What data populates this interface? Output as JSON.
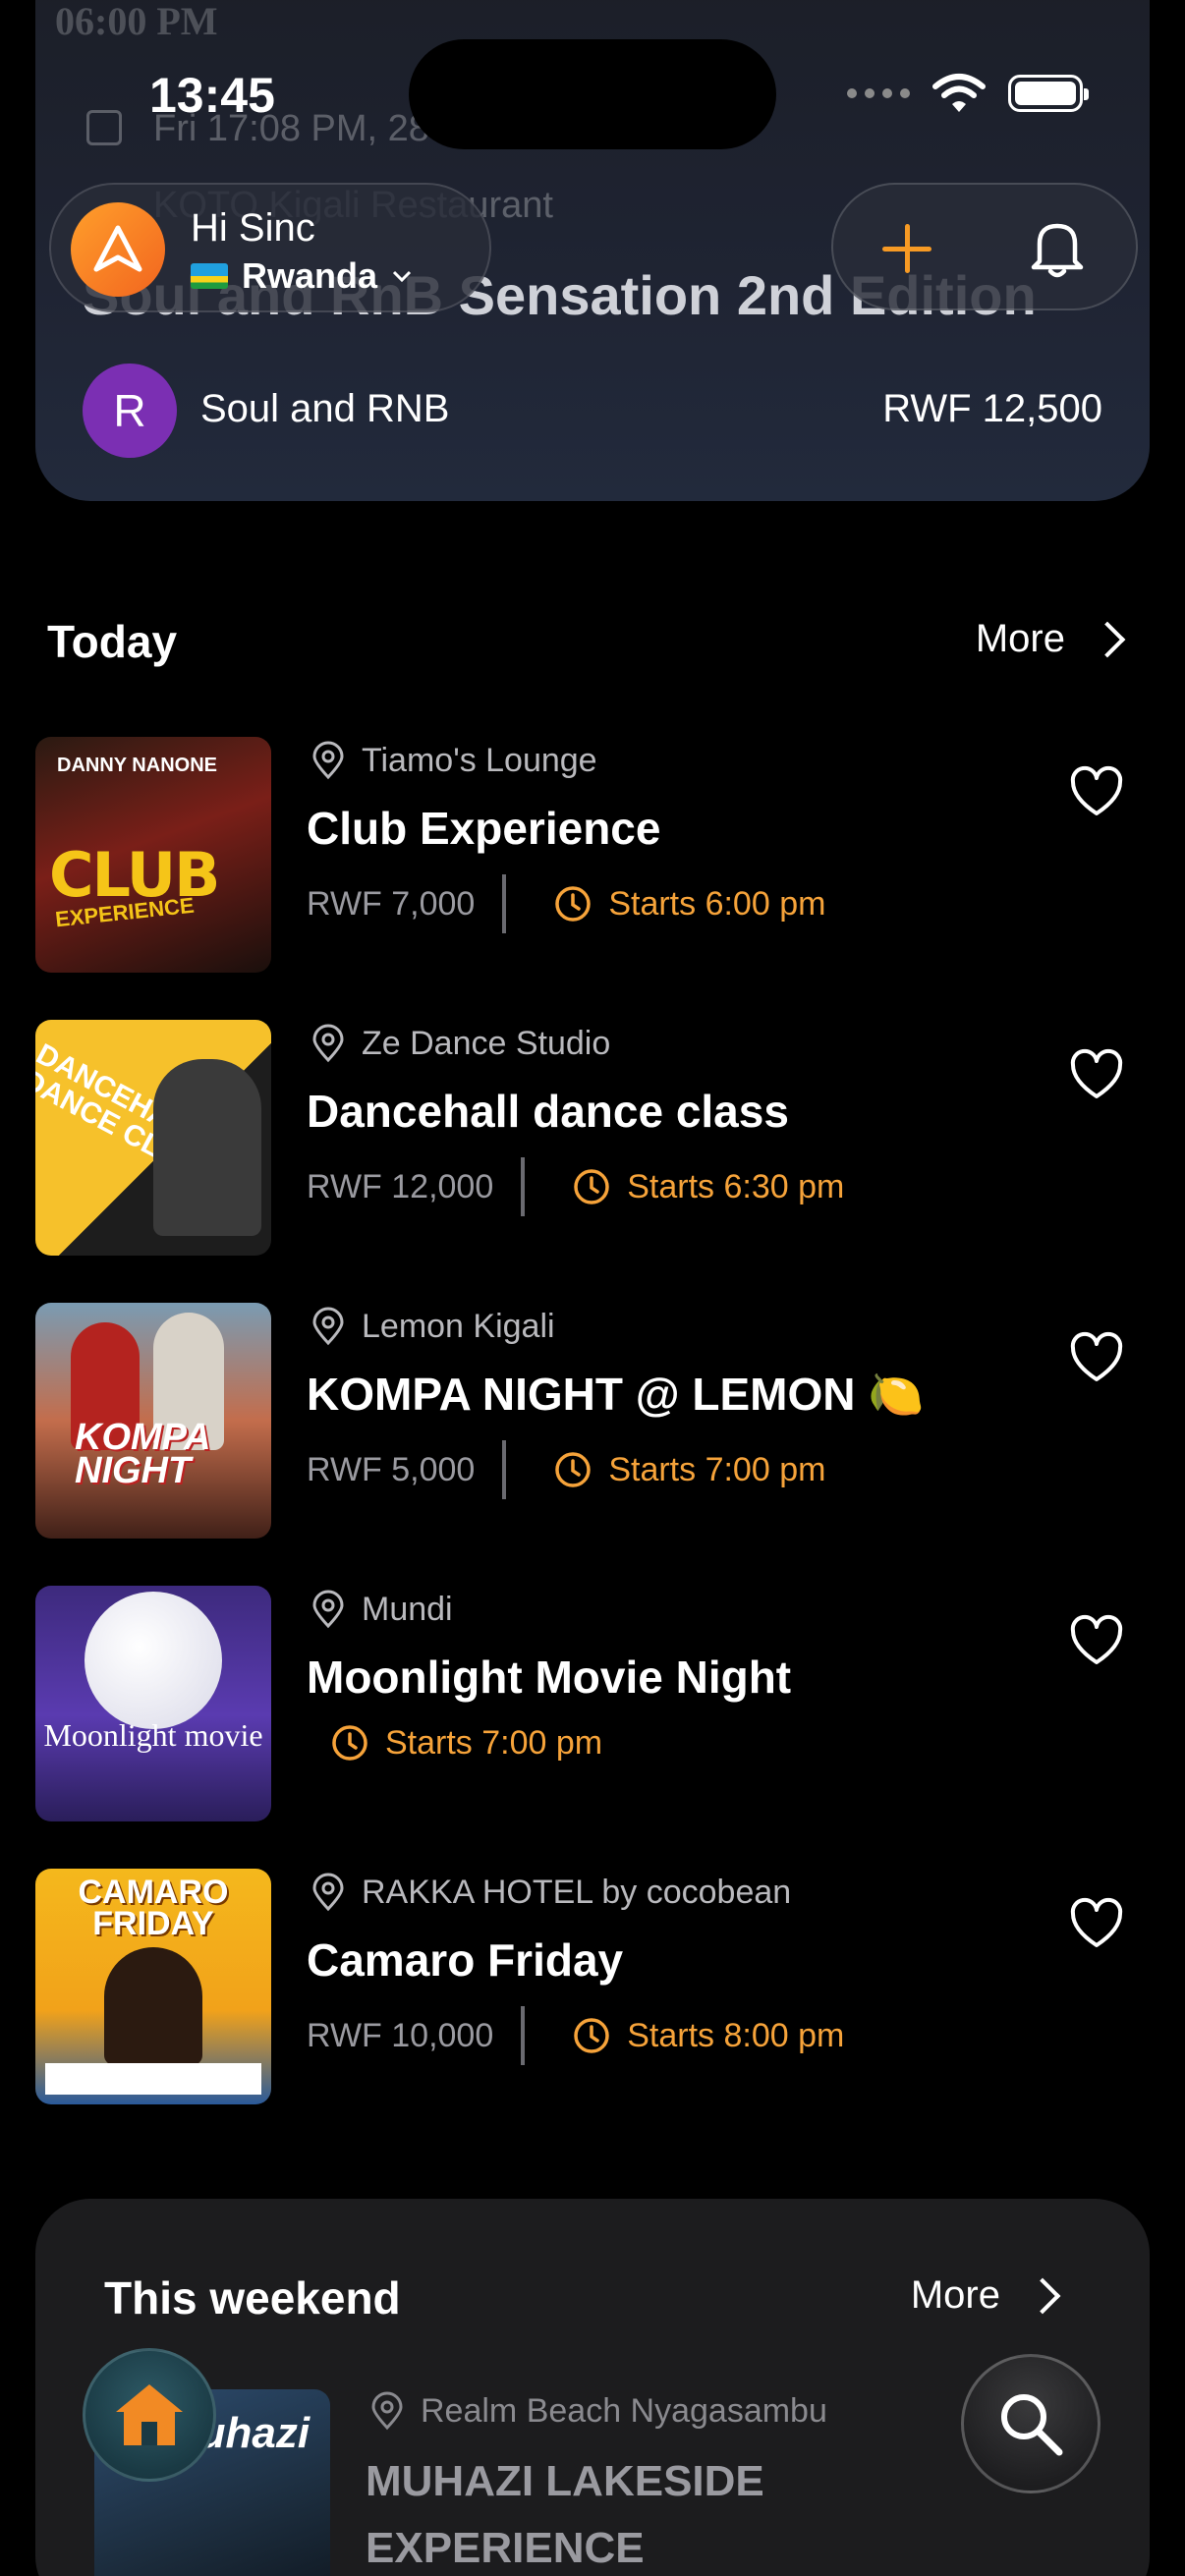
{
  "status_bar": {
    "time": "13:45"
  },
  "hero": {
    "ghost_time": "06:00 PM",
    "date": "Fri 17:08 PM, 28 Aug",
    "venue": "KOTO Kigali Restaurant",
    "title": "Soul and RnB Sensation 2nd Edition",
    "organizer_initial": "R",
    "organizer_name": "Soul and RNB",
    "price": "RWF 12,500"
  },
  "header": {
    "greeting": "Hi Sinc",
    "country": "Rwanda",
    "icons": {
      "logo": "app-logo-icon",
      "add": "plus-icon",
      "notifications": "bell-icon"
    }
  },
  "today": {
    "title": "Today",
    "more_label": "More",
    "events": [
      {
        "venue": "Tiamo's Lounge",
        "title": "Club Experience",
        "price": "RWF 7,000",
        "start": "Starts 6:00 pm",
        "thumb": {
          "name": "DANNY NANONE",
          "big": "CLUB",
          "sub": "EXPERIENCE"
        }
      },
      {
        "venue": "Ze Dance Studio",
        "title": "Dancehall dance class",
        "price": "RWF 12,000",
        "start": "Starts 6:30 pm",
        "thumb": {
          "text": "DANCEHALL DANCE CLASS"
        }
      },
      {
        "venue": "Lemon Kigali",
        "title": "KOMPA NIGHT @ LEMON 🍋",
        "price": "RWF 5,000",
        "start": "Starts 7:00 pm",
        "thumb": {
          "text": "KOMPA NIGHT"
        }
      },
      {
        "venue": "Mundi",
        "title": "Moonlight Movie Night",
        "price": "",
        "start": "Starts 7:00 pm",
        "thumb": {
          "text": "Moonlight movie"
        }
      },
      {
        "venue": "RAKKA HOTEL by cocobean",
        "title": "Camaro Friday",
        "price": "RWF 10,000",
        "start": "Starts 8:00 pm",
        "thumb": {
          "text": "CAMARO FRIDAY"
        }
      }
    ]
  },
  "weekend": {
    "title": "This weekend",
    "more_label": "More",
    "event": {
      "venue": "Realm Beach Nyagasambu",
      "title": "MUHAZI LAKESIDE EXPERIENCE",
      "thumb_text": "Muhazi"
    }
  },
  "colors": {
    "accent": "#f6a33a",
    "background": "#000000",
    "card": "#1c1c1e"
  }
}
